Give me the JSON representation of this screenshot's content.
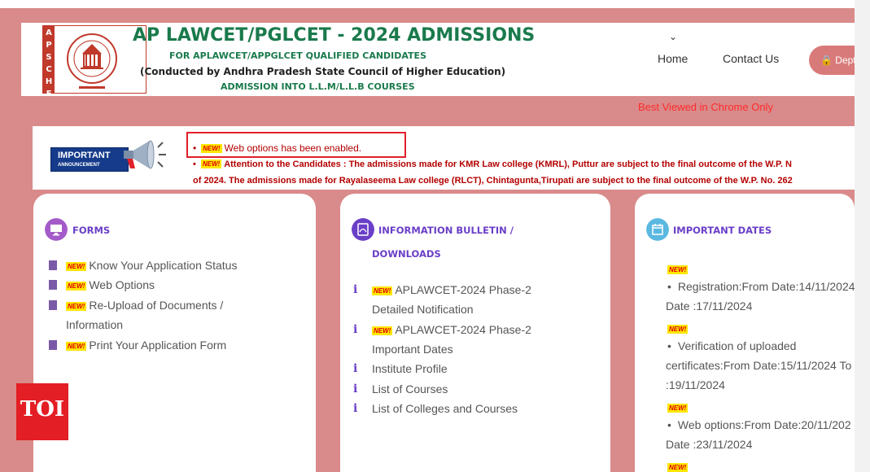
{
  "header": {
    "logo_letters": [
      "A",
      "P",
      "S",
      "C",
      "H",
      "E"
    ],
    "title": "AP LAWCET/PGLCET - 2024 ADMISSIONS",
    "subtitle1": "FOR APLAWCET/APPGLCET QUALIFIED CANDIDATES",
    "subtitle2": "(Conducted by Andhra Pradesh State Council of Higher Education)",
    "subtitle3": "ADMISSION INTO L.L.M/L.L.B COURSES"
  },
  "nav": {
    "chevron": "⌄",
    "home": "Home",
    "contact": "Contact Us",
    "dept": "🔒 Dept"
  },
  "best_viewed": "Best Viewed in Chrome Only",
  "announcement": {
    "badge_line1": "IMPORTANT",
    "badge_line2": "ANNOUNCEMENT",
    "new_tag": "NEW!",
    "item1": "Web options has been enabled.",
    "item2": "Attention to the Candidates : The admissions made for KMR Law college (KMRL), Puttur are subject to the final outcome of the W.P. N",
    "item3": "of 2024. The admissions made for Rayalaseema Law college (RLCT), Chintagunta,Tirupati are subject to the final outcome of the W.P. No. 262"
  },
  "forms": {
    "title": "FORMS",
    "items": [
      {
        "label": "Know Your Application Status"
      },
      {
        "label": "Web Options"
      },
      {
        "label": "Re-Upload of Documents /"
      },
      {
        "label": "Information"
      },
      {
        "label": "Print Your Application Form"
      }
    ]
  },
  "bulletin": {
    "title_line1": "INFORMATION BULLETIN /",
    "title_line2": "DOWNLOADS",
    "items": [
      {
        "label": "APLAWCET-2024 Phase-2"
      },
      {
        "label": "Detailed Notification"
      },
      {
        "label": "APLAWCET-2024 Phase-2"
      },
      {
        "label": "Important Dates"
      },
      {
        "label": "Institute Profile"
      },
      {
        "label": "List of Courses"
      },
      {
        "label": "List of Colleges and Courses"
      }
    ]
  },
  "dates": {
    "title": "IMPORTANT DATES",
    "lines": [
      "Registration:From Date:14/11/2024",
      "Date :17/11/2024",
      "Verification of uploaded",
      "certificates:From Date:15/11/2024 To",
      ":19/11/2024",
      "Web options:From Date:20/11/202",
      "Date :23/11/2024"
    ]
  },
  "watermark": "TOI",
  "colors": {
    "page_bg": "#d98a8a",
    "title_green": "#1a7a4c",
    "accent_purple": "#6a3fc7",
    "alert_red": "#e0202a"
  }
}
